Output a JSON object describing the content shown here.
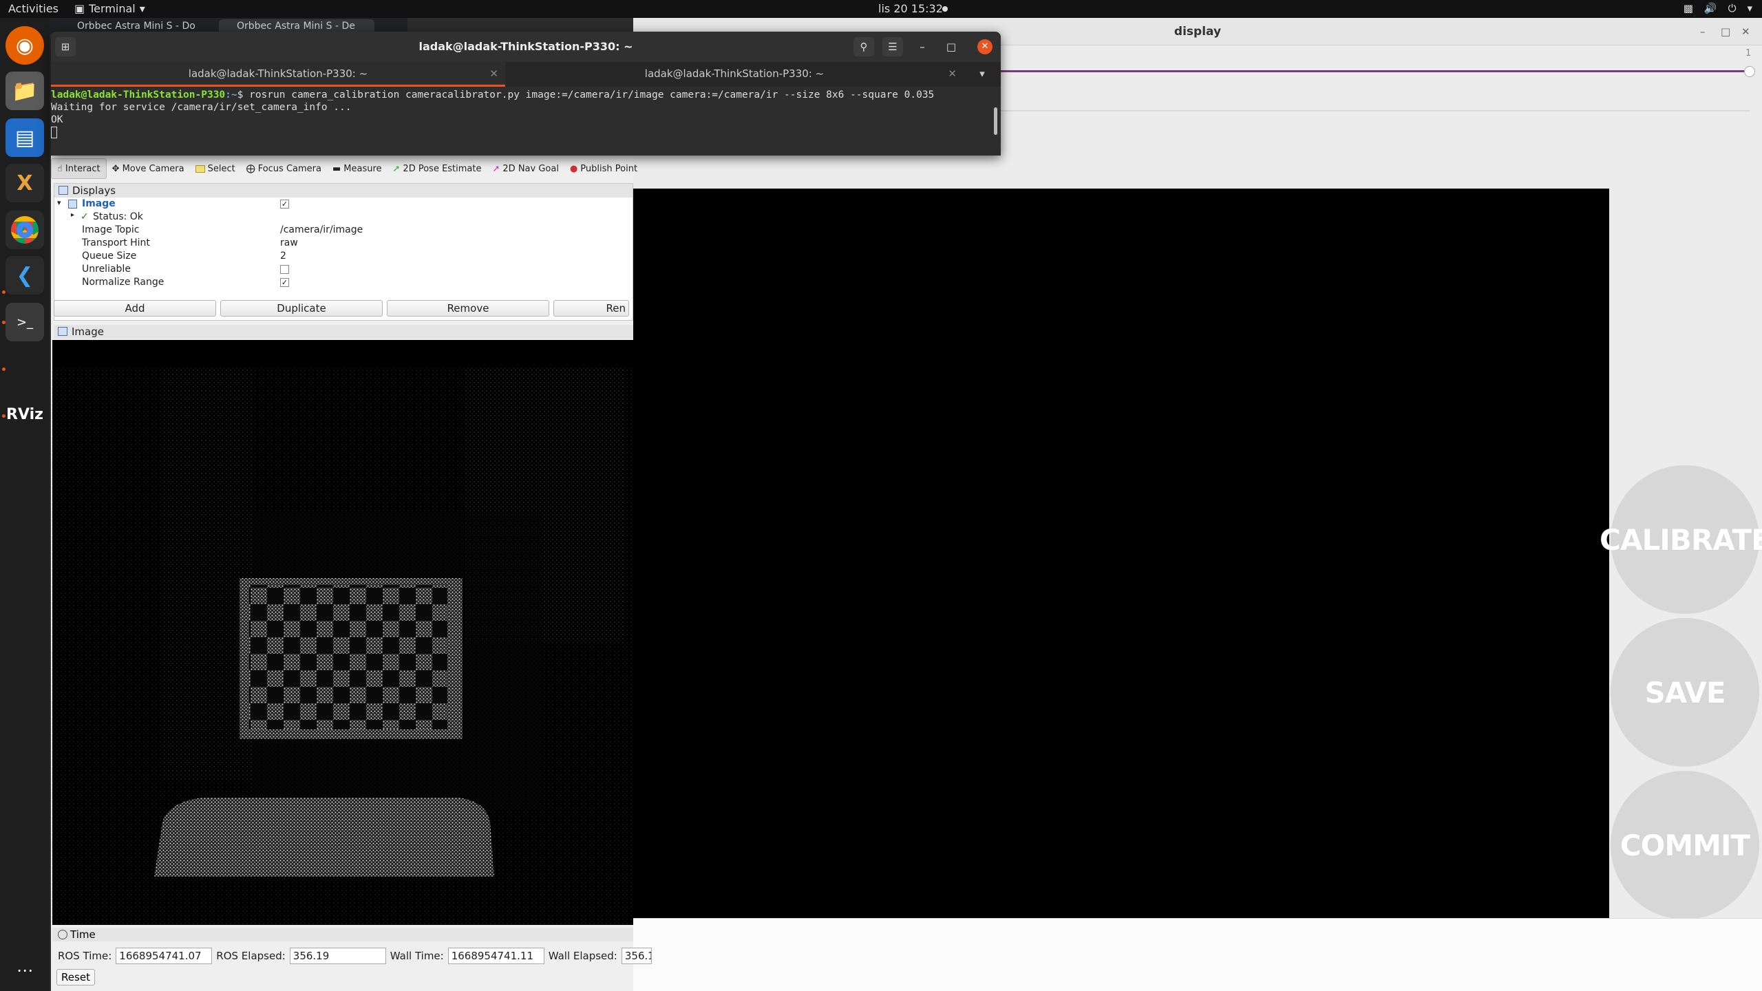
{
  "topbar": {
    "activities": "Activities",
    "app_menu": "Terminal",
    "clock": "lis 20  15:32"
  },
  "browser_tabs": [
    {
      "label": "Orbbec Astra Mini S - Do"
    },
    {
      "label": "Orbbec Astra Mini S - De"
    }
  ],
  "terminal": {
    "title": "ladak@ladak-ThinkStation-P330: ~",
    "tabs": [
      {
        "label": "ladak@ladak-ThinkStation-P330: ~"
      },
      {
        "label": "ladak@ladak-ThinkStation-P330: ~"
      }
    ],
    "prompt_user": "ladak@ladak-ThinkStation-P330",
    "prompt_path": ":~",
    "command": "$ rosrun camera_calibration cameracalibrator.py image:=/camera/ir/image camera:=/camera/ir --size 8x6 --square 0.035",
    "output": [
      "Waiting for service /camera/ir/set_camera_info ...",
      "OK"
    ]
  },
  "display": {
    "title": "display",
    "slider_value": "1",
    "buttons": {
      "calibrate": "CALIBRATE",
      "save": "SAVE",
      "commit": "COMMIT"
    }
  },
  "rviz": {
    "tools": [
      {
        "label": "Interact",
        "icon": "hand-icon"
      },
      {
        "label": "Move Camera",
        "icon": "move-icon"
      },
      {
        "label": "Select",
        "icon": "select-icon"
      },
      {
        "label": "Focus Camera",
        "icon": "focus-icon"
      },
      {
        "label": "Measure",
        "icon": "ruler-icon"
      },
      {
        "label": "2D Pose Estimate",
        "icon": "arrow-green-icon"
      },
      {
        "label": "2D Nav Goal",
        "icon": "arrow-pink-icon"
      },
      {
        "label": "Publish Point",
        "icon": "pin-icon"
      }
    ],
    "displays": {
      "title": "Displays",
      "image": {
        "label": "Image",
        "status": "Status: Ok",
        "props": [
          {
            "key": "Image Topic",
            "value": "/camera/ir/image"
          },
          {
            "key": "Transport Hint",
            "value": "raw"
          },
          {
            "key": "Queue Size",
            "value": "2"
          },
          {
            "key": "Unreliable",
            "value": ""
          },
          {
            "key": "Normalize Range",
            "value": ""
          }
        ]
      },
      "buttons": {
        "add": "Add",
        "duplicate": "Duplicate",
        "remove": "Remove",
        "rename": "Ren"
      }
    },
    "image_panel_title": "Image",
    "time": {
      "title": "Time",
      "ros_time_label": "ROS Time:",
      "ros_time": "1668954741.07",
      "ros_elapsed_label": "ROS Elapsed:",
      "ros_elapsed": "356.19",
      "wall_time_label": "Wall Time:",
      "wall_time": "1668954741.11",
      "wall_elapsed_label": "Wall Elapsed:",
      "wall_elapsed": "356.1",
      "reset": "Reset"
    }
  }
}
